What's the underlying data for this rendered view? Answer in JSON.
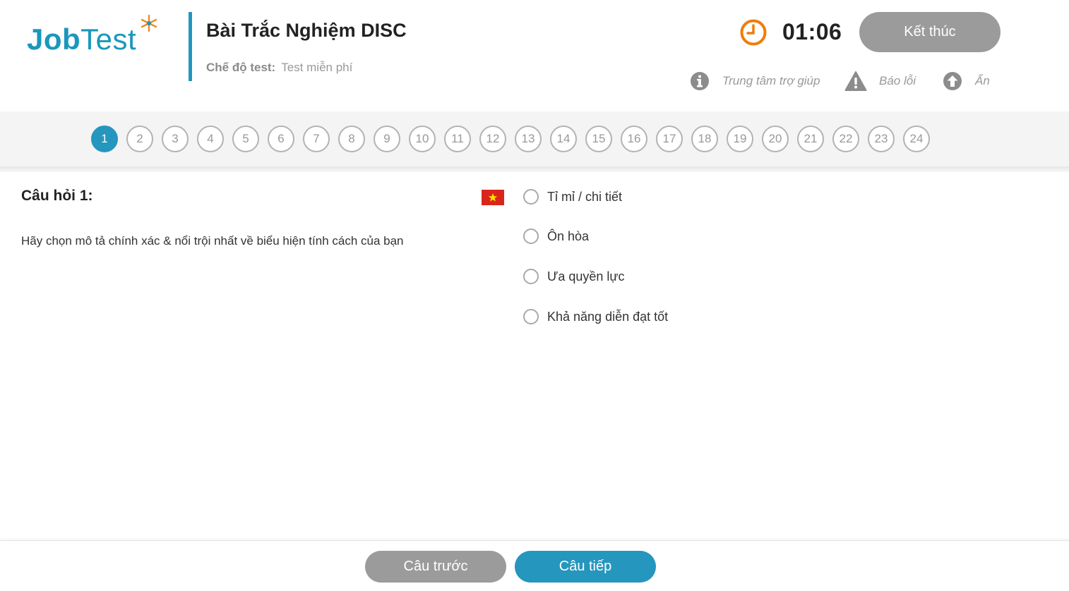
{
  "brand": {
    "logo_bold": "Job",
    "logo_light": "Test",
    "logo_accent_color": "#1a97bd",
    "star_color": "#f08a24"
  },
  "header": {
    "title": "Bài Trắc Nghiệm DISC",
    "mode_label": "Chế độ test:",
    "mode_value": "Test miễn phí",
    "timer": "01:06",
    "finish_label": "Kết thúc",
    "help_label": "Trung tâm trợ giúp",
    "report_label": "Báo lỗi",
    "hide_label": "Ẩn"
  },
  "question_nav": {
    "current": 1,
    "numbers": [
      "1",
      "2",
      "3",
      "4",
      "5",
      "6",
      "7",
      "8",
      "9",
      "10",
      "11",
      "12",
      "13",
      "14",
      "15",
      "16",
      "17",
      "18",
      "19",
      "20",
      "21",
      "22",
      "23",
      "24"
    ],
    "active_color": "#2596be"
  },
  "question": {
    "title": "Câu hỏi 1:",
    "text": "Hãy chọn mô tả chính xác & nổi trội nhất về biểu hiện tính cách của bạn",
    "language_flag": "vietnam-flag-icon",
    "options": [
      "Tỉ mỉ / chi tiết",
      "Ôn hòa",
      "Ưa quyền lực",
      "Khả năng diễn đạt tốt"
    ]
  },
  "footer": {
    "prev_label": "Câu trước",
    "next_label": "Câu tiếp"
  }
}
